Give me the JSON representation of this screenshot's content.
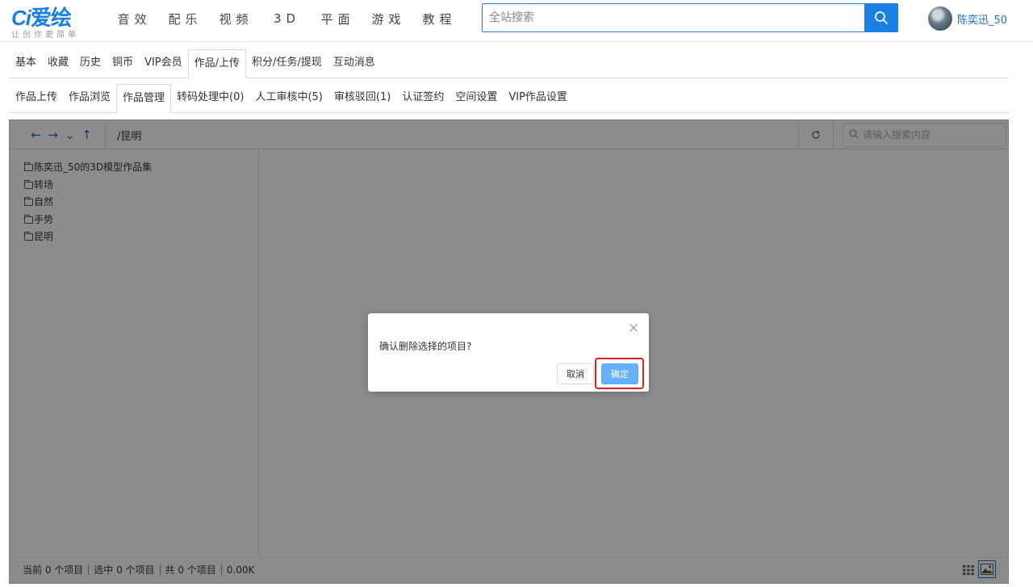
{
  "brand": {
    "logo_text": "爱绘",
    "tagline": "让创作更简单",
    "accent_color": "#1a7fe0"
  },
  "nav": [
    "音效",
    "配乐",
    "视频",
    "3D",
    "平面",
    "游戏",
    "教程"
  ],
  "search": {
    "placeholder": "全站搜索",
    "icon": "search-icon"
  },
  "user": {
    "name": "陈奕迅_50"
  },
  "tabs_primary": [
    {
      "label": "基本",
      "active": false
    },
    {
      "label": "收藏",
      "active": false
    },
    {
      "label": "历史",
      "active": false
    },
    {
      "label": "铜币",
      "active": false
    },
    {
      "label": "VIP会员",
      "active": false
    },
    {
      "label": "作品/上传",
      "active": true
    },
    {
      "label": "积分/任务/提现",
      "active": false
    },
    {
      "label": "互动消息",
      "active": false
    }
  ],
  "tabs_secondary": [
    {
      "label": "作品上传",
      "active": false
    },
    {
      "label": "作品浏览",
      "active": false
    },
    {
      "label": "作品管理",
      "active": true
    },
    {
      "label": "转码处理中(0)",
      "active": false
    },
    {
      "label": "人工审核中(5)",
      "active": false
    },
    {
      "label": "审核驳回(1)",
      "active": false
    },
    {
      "label": "认证签约",
      "active": false
    },
    {
      "label": "空间设置",
      "active": false
    },
    {
      "label": "VIP作品设置",
      "active": false
    }
  ],
  "file_manager": {
    "nav_icons": [
      "←",
      "→",
      "⌄",
      "↑"
    ],
    "path": "/昆明",
    "search_placeholder": "请输入搜索内容",
    "tree": [
      "陈奕迅_50的3D模型作品集",
      "转场",
      "自然",
      "手势",
      "昆明"
    ],
    "status": {
      "current": "当前 0 个项目",
      "selected": "选中 0 个项目",
      "total": "共 0 个项目",
      "size": "0.00K"
    }
  },
  "dialog": {
    "message": "确认删除选择的项目?",
    "cancel_label": "取消",
    "confirm_label": "确定",
    "confirm_color": "#66b1ff",
    "highlight_color": "#e02020"
  }
}
